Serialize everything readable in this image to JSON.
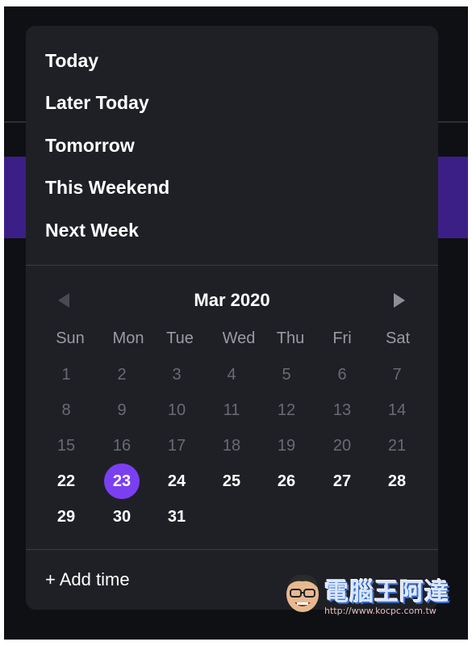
{
  "quick_options": [
    {
      "label": "Today"
    },
    {
      "label": "Later Today"
    },
    {
      "label": "Tomorrow"
    },
    {
      "label": "This Weekend"
    },
    {
      "label": "Next Week"
    }
  ],
  "calendar": {
    "month_label": "Mar 2020",
    "prev_icon": "chevron-left-icon",
    "next_icon": "chevron-right-icon",
    "weekdays": [
      "Sun",
      "Mon",
      "Tue",
      "Wed",
      "Thu",
      "Fri",
      "Sat"
    ],
    "past_days": [
      "1",
      "2",
      "3",
      "4",
      "5",
      "6",
      "7",
      "8",
      "9",
      "10",
      "11",
      "12",
      "13",
      "14",
      "15",
      "16",
      "17",
      "18",
      "19",
      "20",
      "21"
    ],
    "upcoming_days": [
      "22",
      "23",
      "24",
      "25",
      "26",
      "27",
      "28",
      "29",
      "30",
      "31"
    ],
    "selected_day": "23"
  },
  "add_time_label": "+ Add time",
  "watermark": {
    "text": "電腦王阿達",
    "url": "http://www.kocpc.com.tw"
  },
  "colors": {
    "popup_bg": "#1f2026",
    "selected_day": "#7b3ff2",
    "accent_band": "#3b1f87"
  }
}
